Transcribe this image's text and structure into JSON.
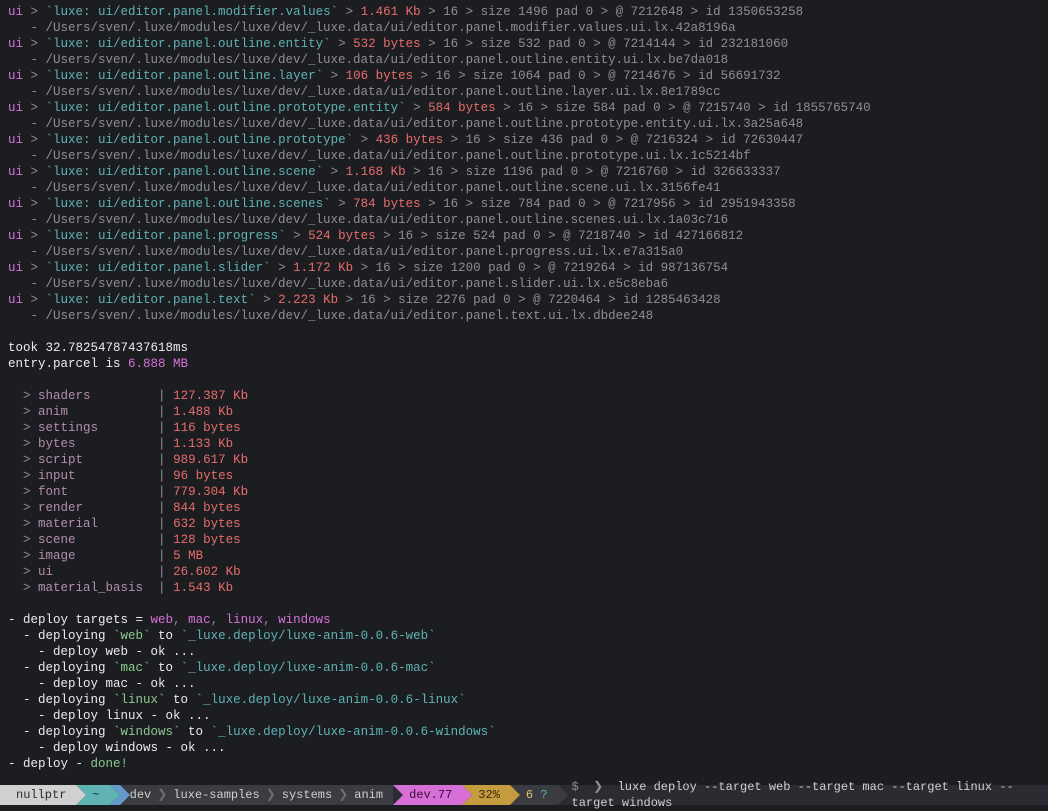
{
  "ui_entries": [
    {
      "name": "ui/editor.panel.modifier.values",
      "size": "1.461 Kb",
      "count": "16",
      "rawsize": "1496",
      "pad": "0",
      "at": "7212648",
      "id": "1350653258",
      "path": "/Users/sven/.luxe/modules/luxe/dev/_luxe.data/ui/editor.panel.modifier.values.ui.lx.42a8196a"
    },
    {
      "name": "ui/editor.panel.outline.entity",
      "size": "532 bytes",
      "count": "16",
      "rawsize": "532",
      "pad": "0",
      "at": "7214144",
      "id": "232181060",
      "path": "/Users/sven/.luxe/modules/luxe/dev/_luxe.data/ui/editor.panel.outline.entity.ui.lx.be7da018"
    },
    {
      "name": "ui/editor.panel.outline.layer",
      "size": "106 bytes",
      "count": "16",
      "rawsize": "1064",
      "pad": "0",
      "at": "7214676",
      "id": "56691732",
      "path": "/Users/sven/.luxe/modules/luxe/dev/_luxe.data/ui/editor.panel.outline.layer.ui.lx.8e1789cc"
    },
    {
      "name": "ui/editor.panel.outline.prototype.entity",
      "size": "584 bytes",
      "count": "16",
      "rawsize": "584",
      "pad": "0",
      "at": "7215740",
      "id": "1855765740",
      "path": "/Users/sven/.luxe/modules/luxe/dev/_luxe.data/ui/editor.panel.outline.prototype.entity.ui.lx.3a25a648"
    },
    {
      "name": "ui/editor.panel.outline.prototype",
      "size": "436 bytes",
      "count": "16",
      "rawsize": "436",
      "pad": "0",
      "at": "7216324",
      "id": "72630447",
      "path": "/Users/sven/.luxe/modules/luxe/dev/_luxe.data/ui/editor.panel.outline.prototype.ui.lx.1c5214bf"
    },
    {
      "name": "ui/editor.panel.outline.scene",
      "size": "1.168 Kb",
      "count": "16",
      "rawsize": "1196",
      "pad": "0",
      "at": "7216760",
      "id": "326633337",
      "path": "/Users/sven/.luxe/modules/luxe/dev/_luxe.data/ui/editor.panel.outline.scene.ui.lx.3156fe41"
    },
    {
      "name": "ui/editor.panel.outline.scenes",
      "size": "784 bytes",
      "count": "16",
      "rawsize": "784",
      "pad": "0",
      "at": "7217956",
      "id": "2951943358",
      "path": "/Users/sven/.luxe/modules/luxe/dev/_luxe.data/ui/editor.panel.outline.scenes.ui.lx.1a03c716"
    },
    {
      "name": "ui/editor.panel.progress",
      "size": "524 bytes",
      "count": "16",
      "rawsize": "524",
      "pad": "0",
      "at": "7218740",
      "id": "427166812",
      "path": "/Users/sven/.luxe/modules/luxe/dev/_luxe.data/ui/editor.panel.progress.ui.lx.e7a315a0"
    },
    {
      "name": "ui/editor.panel.slider",
      "size": "1.172 Kb",
      "count": "16",
      "rawsize": "1200",
      "pad": "0",
      "at": "7219264",
      "id": "987136754",
      "path": "/Users/sven/.luxe/modules/luxe/dev/_luxe.data/ui/editor.panel.slider.ui.lx.e5c8eba6"
    },
    {
      "name": "ui/editor.panel.text",
      "size": "2.223 Kb",
      "count": "16",
      "rawsize": "2276",
      "pad": "0",
      "at": "7220464",
      "id": "1285463428",
      "path": "/Users/sven/.luxe/modules/luxe/dev/_luxe.data/ui/editor.panel.text.ui.lx.dbdee248"
    }
  ],
  "timing": {
    "took_label": "took ",
    "took_value": "32.78254787437618ms",
    "parcel_prefix": "entry.parcel",
    "is": " is ",
    "parcel_size": "6.888 MB"
  },
  "categories": [
    {
      "name": "shaders",
      "size": "127.387 Kb"
    },
    {
      "name": "anim",
      "size": "1.488 Kb"
    },
    {
      "name": "settings",
      "size": "116 bytes"
    },
    {
      "name": "bytes",
      "size": "1.133 Kb"
    },
    {
      "name": "script",
      "size": "989.617 Kb"
    },
    {
      "name": "input",
      "size": "96 bytes"
    },
    {
      "name": "font",
      "size": "779.304 Kb"
    },
    {
      "name": "render",
      "size": "844 bytes"
    },
    {
      "name": "material",
      "size": "632 bytes"
    },
    {
      "name": "scene",
      "size": "128 bytes"
    },
    {
      "name": "image",
      "size": "5 MB"
    },
    {
      "name": "ui",
      "size": "26.602 Kb"
    },
    {
      "name": "material_basis",
      "size": "1.543 Kb"
    }
  ],
  "deploy": {
    "targets_label": "deploy targets = ",
    "targets": [
      "web",
      "mac",
      "linux",
      "windows"
    ],
    "entries": [
      {
        "target": "web",
        "dest": "_luxe.deploy/luxe-anim-0.0.6-web",
        "status": "deploy web - ok ..."
      },
      {
        "target": "mac",
        "dest": "_luxe.deploy/luxe-anim-0.0.6-mac",
        "status": "deploy mac - ok ..."
      },
      {
        "target": "linux",
        "dest": "_luxe.deploy/luxe-anim-0.0.6-linux",
        "status": "deploy linux - ok ..."
      },
      {
        "target": "windows",
        "dest": "_luxe.deploy/luxe-anim-0.0.6-windows",
        "status": "deploy windows - ok ..."
      }
    ],
    "done_prefix": "deploy - ",
    "done": "done!"
  },
  "status": {
    "host": "nullptr",
    "home": "~",
    "crumbs": [
      "dev",
      "luxe-samples",
      "systems",
      "anim"
    ],
    "branch": "dev.77",
    "pct": "32%",
    "count": "6",
    "q": "?",
    "prompt": "$",
    "cmd": "luxe deploy --target web --target mac --target linux --target windows"
  }
}
